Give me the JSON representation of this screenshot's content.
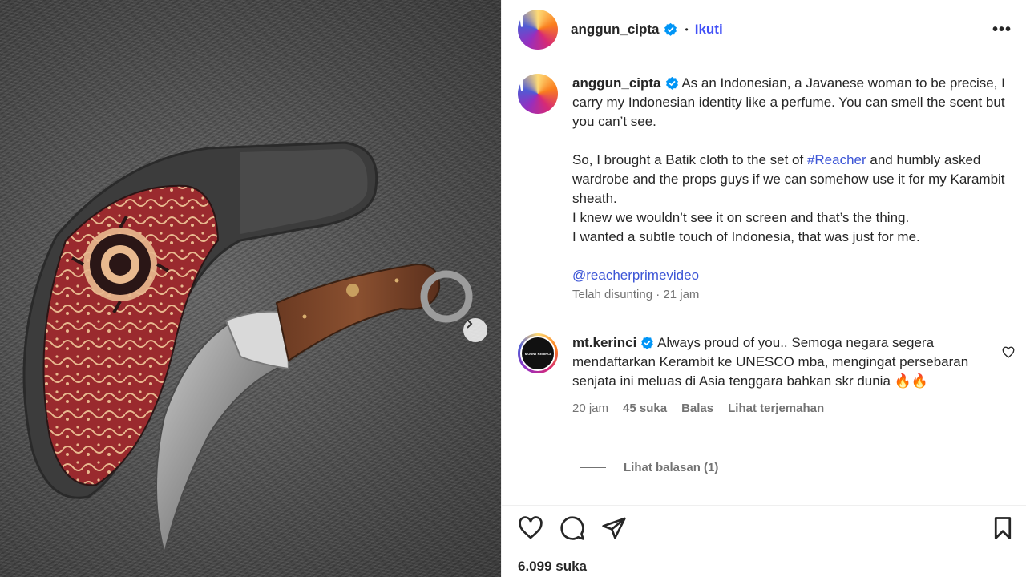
{
  "post": {
    "username": "anggun_cipta",
    "follow_label": "Ikuti",
    "more_label": "•••",
    "caption": {
      "username": "anggun_cipta",
      "p1": "As an Indonesian, a Javanese woman to be precise, I carry my Indonesian identity like a perfume. You can smell the scent but you can’t see.",
      "p2_before": "So, I brought a Batik cloth to the set of ",
      "hashtag": "#Reacher",
      "p2_after": " and humbly asked wardrobe and the props guys if we can somehow use it for my Karambit sheath.",
      "p3": "I knew we wouldn’t see it on screen and that’s the thing.",
      "p4": "I wanted a subtle touch of Indonesia, that was just for me.",
      "mention": "@reacherprimevideo",
      "meta": "Telah disunting · 21 jam"
    },
    "comment": {
      "username": "mt.kerinci",
      "text": "Always proud of you.. Semoga negara segera mendaftarkan Kerambit ke UNESCO mba, mengingat persebaran senjata ini meluas di Asia tenggara bahkan skr dunia 🔥🔥",
      "time": "20 jam",
      "likes": "45 suka",
      "reply": "Balas",
      "translate": "Lihat terjemahan",
      "view_replies": "Lihat balasan (1)",
      "avatar_text": "MOUNT KERINCI"
    },
    "likes": "6.099 suka"
  },
  "icons": {
    "verified": "verified-badge-icon",
    "like": "heart-icon",
    "comment": "comment-bubble-icon",
    "share": "paper-plane-icon",
    "save": "bookmark-icon",
    "next": "chevron-right-icon"
  },
  "colors": {
    "accent": "#4150f7",
    "link": "#3c55d6",
    "muted": "#737373",
    "text": "#262626"
  }
}
